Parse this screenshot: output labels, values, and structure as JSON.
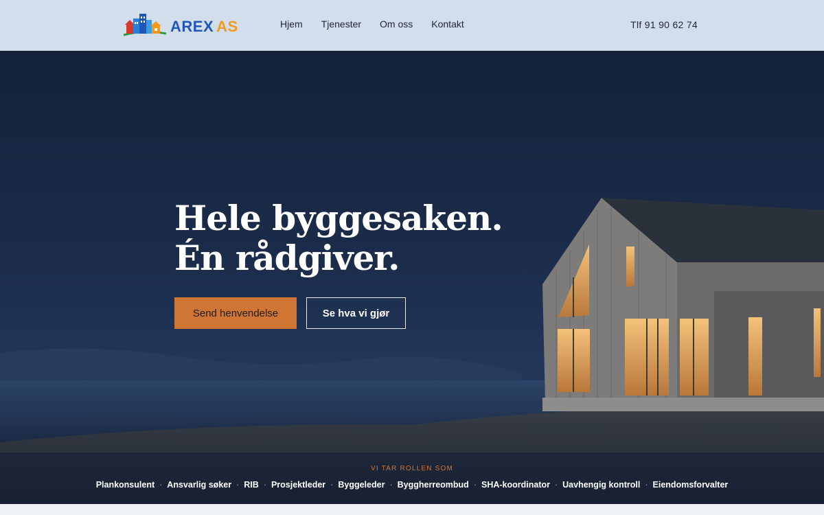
{
  "brand": {
    "name_part1": "AREX",
    "name_part2": "AS",
    "colors": {
      "primary_blue": "#1f56b8",
      "accent_orange": "#f29a1d"
    },
    "icon": "buildings-logo-icon"
  },
  "nav": {
    "items": [
      {
        "label": "Hjem"
      },
      {
        "label": "Tjenester"
      },
      {
        "label": "Om oss"
      },
      {
        "label": "Kontakt"
      }
    ],
    "phone": "Tlf 91 90 62 74"
  },
  "hero": {
    "headline_line1": "Hele byggesaken.",
    "headline_line2": "Én rådgiver.",
    "primary_cta": "Send henvendelse",
    "secondary_cta": "Se hva vi gjør",
    "accent_color": "#d07534"
  },
  "roles": {
    "label": "VI TAR ROLLEN SOM",
    "items": [
      "Plankonsulent",
      "Ansvarlig søker",
      "RIB",
      "Prosjektleder",
      "Byggeleder",
      "Byggherreombud",
      "SHA-koordinator",
      "Uavhengig kontroll",
      "Eiendomsforvalter"
    ],
    "separator": "·"
  }
}
